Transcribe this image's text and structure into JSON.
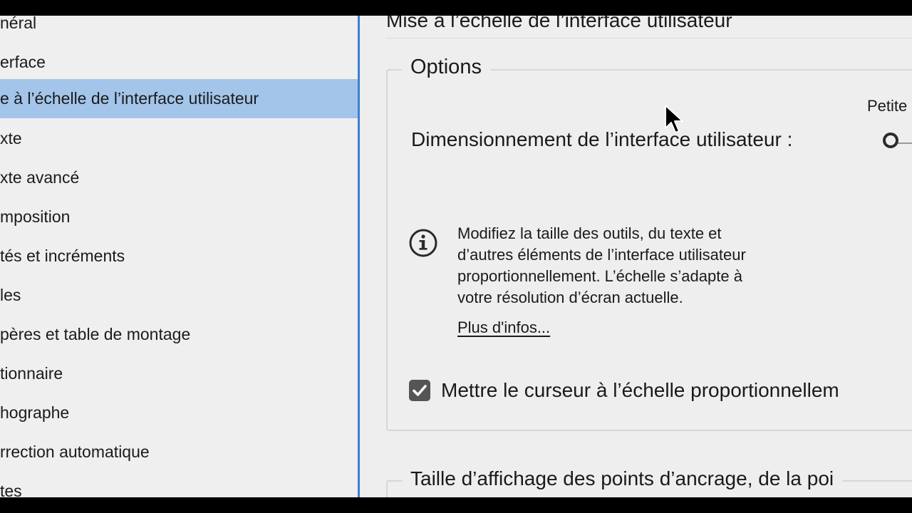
{
  "sidebar": {
    "items": [
      {
        "label": "néral"
      },
      {
        "label": "erface"
      },
      {
        "label": "e à l’échelle de l’interface utilisateur",
        "active": true
      },
      {
        "label": "xte"
      },
      {
        "label": "xte avancé"
      },
      {
        "label": "mposition"
      },
      {
        "label": "tés et incréments"
      },
      {
        "label": "les"
      },
      {
        "label": "pères et table de montage"
      },
      {
        "label": "tionnaire"
      },
      {
        "label": "hographe"
      },
      {
        "label": "rrection automatique"
      },
      {
        "label": "tes"
      }
    ]
  },
  "main": {
    "page_title": "Mise à l’échelle de l’interface utilisateur",
    "options": {
      "legend": "Options",
      "slider_min_label": "Petite",
      "dimension_label": "Dimensionnement de l’interface utilisateur :",
      "info_lines": [
        "Modifiez la taille des outils, du texte et",
        "d’autres éléments de l’interface utilisateur",
        "proportionnellement. L’échelle s’adapte à",
        "votre résolution d’écran actuelle."
      ],
      "more_link": "Plus d'infos...",
      "checkbox_label": "Mettre le curseur à l’échelle proportionnellem",
      "checkbox_checked": true
    },
    "anchor_section": {
      "legend": "Taille d’affichage des points d’ancrage, de la poi"
    }
  },
  "icons": {
    "info": "info-icon",
    "check": "checkmark-icon",
    "cursor": "mouse-pointer-icon"
  },
  "colors": {
    "selection": "#a3c5ea",
    "sidebar_divider": "#3f7fd0",
    "background": "#eeeeee"
  }
}
